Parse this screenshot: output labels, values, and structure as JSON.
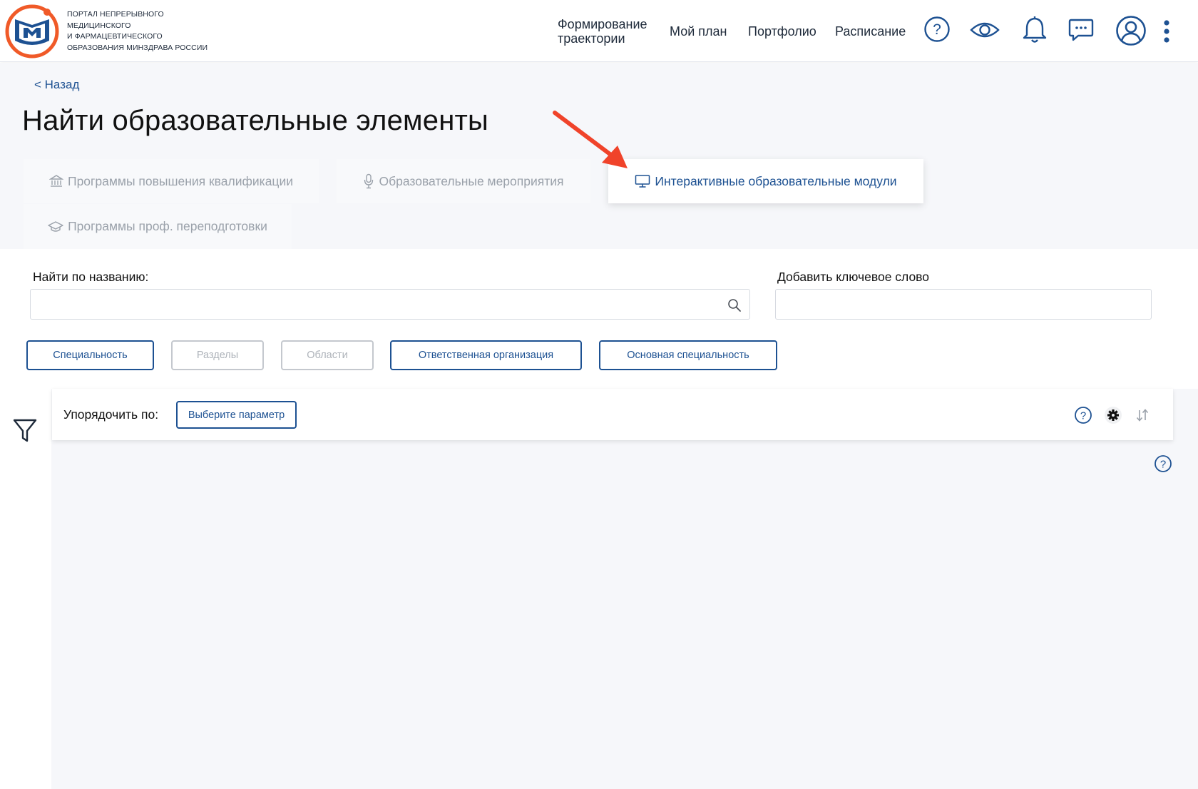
{
  "header": {
    "logo_lines": [
      "ПОРТАЛ НЕПРЕРЫВНОГО",
      "МЕДИЦИНСКОГО",
      "И ФАРМАЦЕВТИЧЕСКОГО",
      "ОБРАЗОВАНИЯ МИНЗДРАВА РОССИИ"
    ],
    "nav": {
      "trajectory_line1": "Формирование",
      "trajectory_line2": "траектории",
      "plan": "Мой план",
      "portfolio": "Портфолио",
      "schedule": "Расписание"
    },
    "icons": [
      "help-icon",
      "eye-icon",
      "bell-icon",
      "chat-icon",
      "user-icon",
      "more-vertical-icon"
    ]
  },
  "back_label": "< Назад",
  "page_title": "Найти образовательные элементы",
  "tabs": [
    {
      "label": "Программы повышения квалификации",
      "icon": "institution-icon",
      "active": false
    },
    {
      "label": "Образовательные мероприятия",
      "icon": "microphone-icon",
      "active": false
    },
    {
      "label": "Интерактивные образовательные модули",
      "icon": "monitor-icon",
      "active": true
    },
    {
      "label": "Программы проф. переподготовки",
      "icon": "graduation-cap-icon",
      "active": false
    }
  ],
  "search": {
    "name_label": "Найти по названию:",
    "name_value": "",
    "keyword_label": "Добавить ключевое слово",
    "keyword_value": ""
  },
  "filters": [
    {
      "label": "Специальность",
      "enabled": true
    },
    {
      "label": "Разделы",
      "enabled": false
    },
    {
      "label": "Области",
      "enabled": false
    },
    {
      "label": "Ответственная организация",
      "enabled": true
    },
    {
      "label": "Основная специальность",
      "enabled": true
    }
  ],
  "sort": {
    "label": "Упорядочить по:",
    "select_label": "Выберите параметр"
  },
  "colors": {
    "brand_blue": "#1d5192",
    "brand_orange": "#f05a28",
    "annotation_red": "#f0432a",
    "background_grey": "#f6f7fa"
  }
}
